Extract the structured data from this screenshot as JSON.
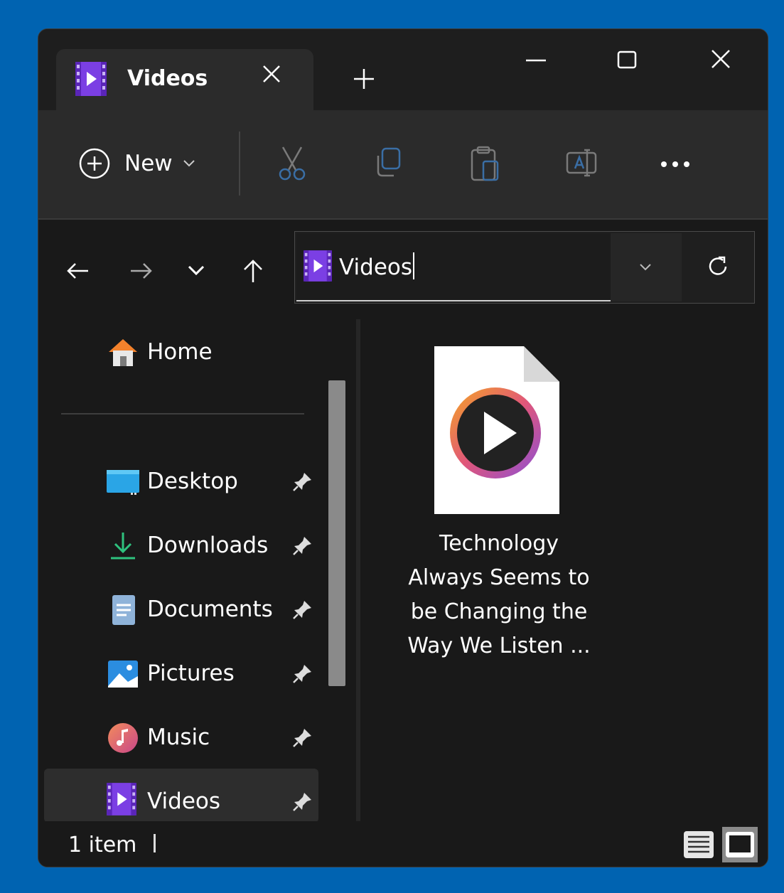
{
  "tab": {
    "title": "Videos",
    "icon": "videos-folder-icon"
  },
  "command_bar": {
    "new_label": "New"
  },
  "address": {
    "path": "Videos"
  },
  "sidebar": {
    "home": "Home",
    "items": [
      {
        "label": "Desktop",
        "icon": "desktop-icon",
        "pinned": true
      },
      {
        "label": "Downloads",
        "icon": "download-arrow-icon",
        "pinned": true
      },
      {
        "label": "Documents",
        "icon": "document-icon",
        "pinned": true
      },
      {
        "label": "Pictures",
        "icon": "pictures-icon",
        "pinned": true
      },
      {
        "label": "Music",
        "icon": "music-note-icon",
        "pinned": true
      },
      {
        "label": "Videos",
        "icon": "videos-folder-icon",
        "pinned": true,
        "selected": true
      }
    ]
  },
  "files": [
    {
      "name": "Technology\nAlways Seems to\nbe Changing the\nWay We Listen ...",
      "icon": "video-file-icon"
    }
  ],
  "status": {
    "item_count": "1 item"
  },
  "colors": {
    "desktop_bg": "#0063b1",
    "window_bg": "#191919",
    "accent_purple": "#7b3fe4"
  }
}
